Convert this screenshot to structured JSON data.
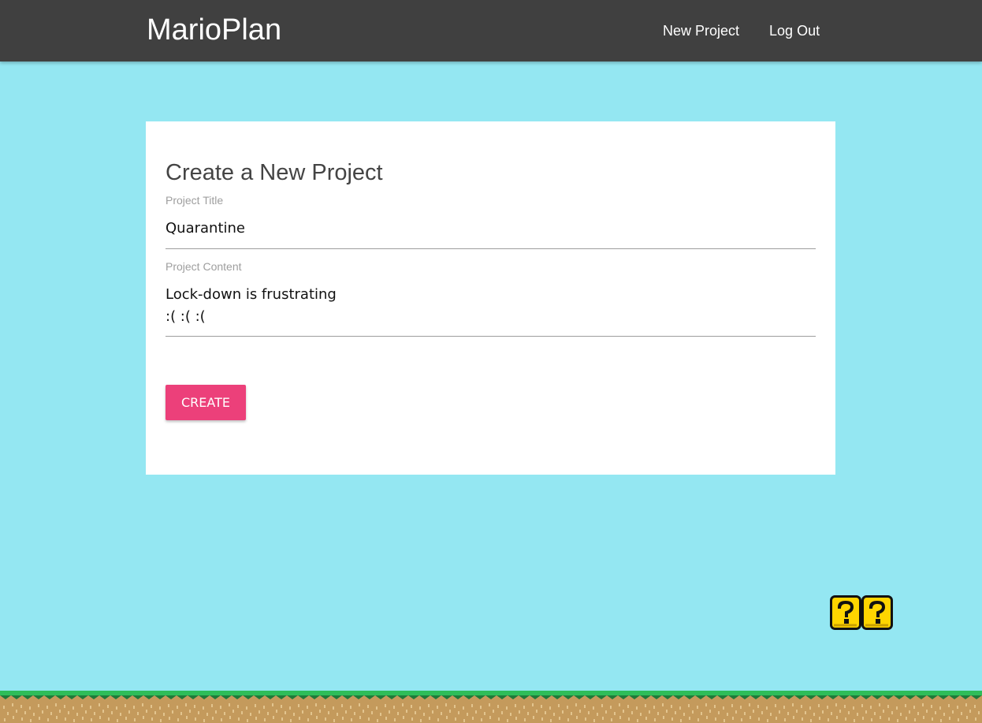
{
  "header": {
    "brand": "MarioPlan",
    "links": [
      {
        "label": "New Project"
      },
      {
        "label": "Log Out"
      }
    ]
  },
  "form": {
    "title": "Create a New Project",
    "fields": [
      {
        "label": "Project Title",
        "value": "Quarantine"
      },
      {
        "label": "Project Content",
        "value": "Lock-down is frustrating\n:( :( :("
      }
    ],
    "submit_label": "CREATE"
  },
  "colors": {
    "sky": "#94E7F2",
    "nav_bg": "#404040",
    "nav_text": "#FFFFFF",
    "card_bg": "#FFFFFF",
    "heading_text": "#444444",
    "label_text": "#9E9E9E",
    "button_bg": "#EC407A",
    "grass": "#2EBD59",
    "grass_dark": "#1F7A3A",
    "dirt": "#C49A5C",
    "dirt_speck": "#E2C48E",
    "block_yellow": "#FFD500",
    "block_outline": "#111111"
  },
  "icons": {
    "question_blocks": "mario-question-block-icon"
  }
}
